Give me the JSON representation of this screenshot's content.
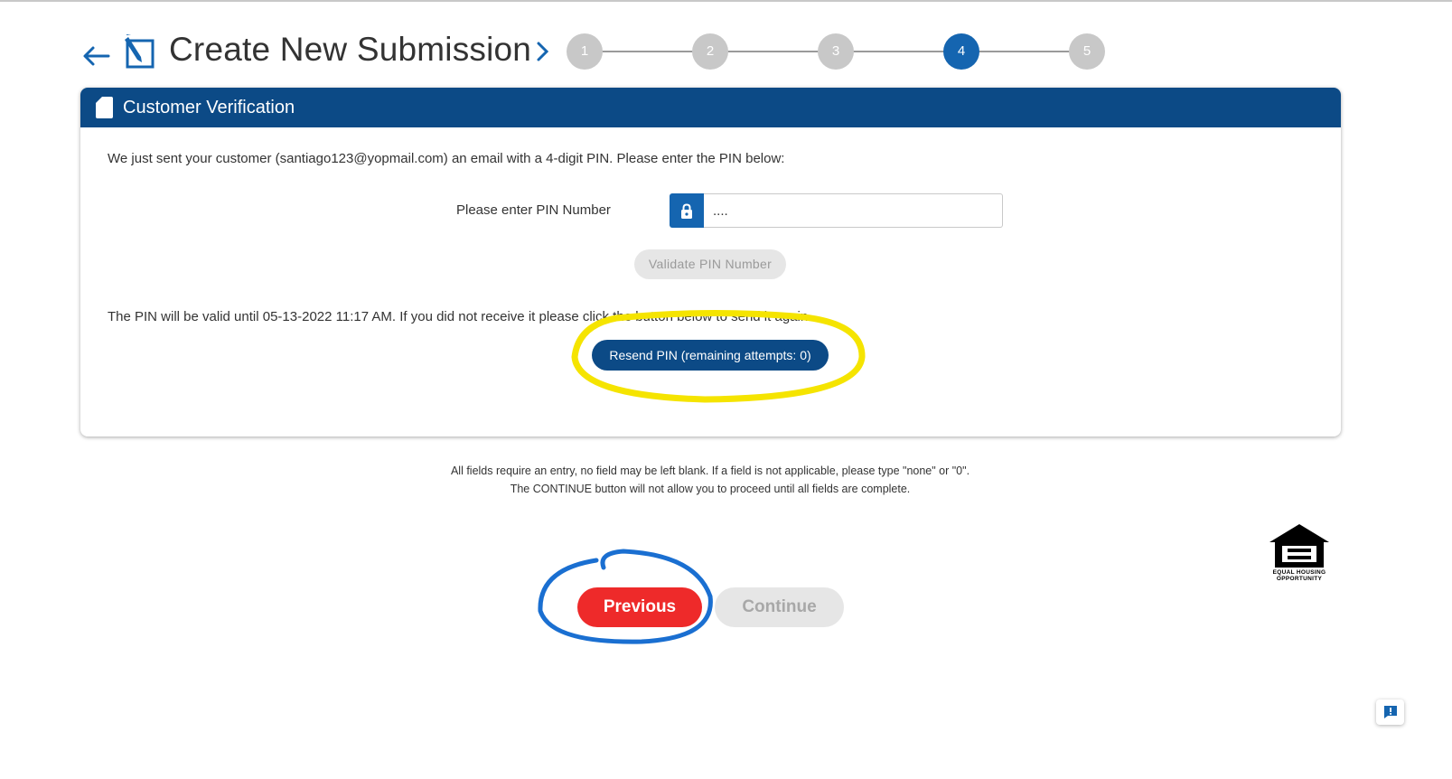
{
  "header": {
    "title": "Create New Submission",
    "steps": [
      "1",
      "2",
      "3",
      "4",
      "5"
    ],
    "active_step": 4
  },
  "card": {
    "title": "Customer Verification",
    "intro": "We just sent your customer (santiago123@yopmail.com) an email with a 4-digit PIN. Please enter the PIN below:",
    "pin_label": "Please enter PIN Number",
    "pin_value": "....",
    "validate_label": "Validate PIN Number",
    "valid_text": "The PIN will be valid until 05-13-2022 11:17 AM. If you did not receive it please click the button below to send it again",
    "resend_label": "Resend PIN (remaining attempts: 0)"
  },
  "footer": {
    "note1": "All fields require an entry, no field may be left blank. If a field is not applicable, please type \"none\" or \"0\".",
    "note2": "The CONTINUE button will not allow you to proceed until all fields are complete.",
    "previous_label": "Previous",
    "continue_label": "Continue",
    "eho_line1": "EQUAL HOUSING",
    "eho_line2": "OPPORTUNITY"
  },
  "colors": {
    "brand_blue": "#0c4a86",
    "step_active": "#1565b0",
    "previous_red": "#ee2a2a",
    "highlight_yellow": "#f5e400",
    "highlight_blue": "#1a6fd1"
  }
}
